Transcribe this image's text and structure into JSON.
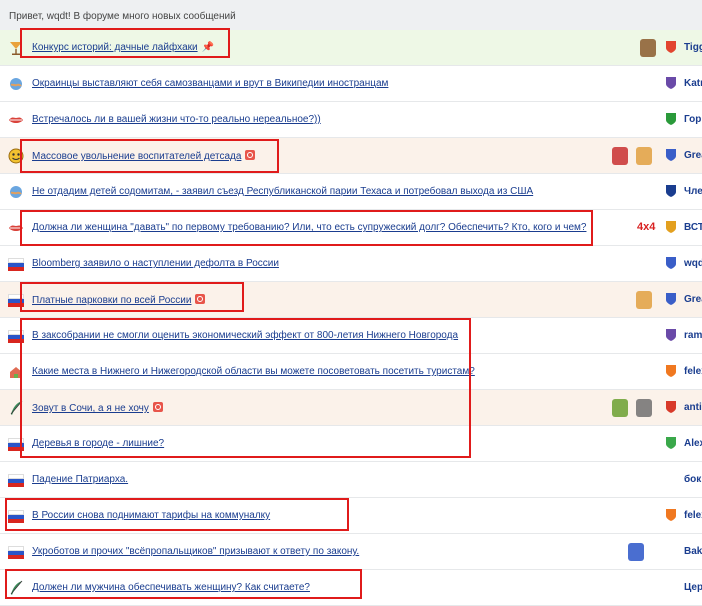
{
  "header": {
    "greeting": "Привет, wqdt! В форуме много новых сообщений"
  },
  "rows": [
    {
      "title": "Конкурс историй: дачные лайфхаки",
      "user": "Tigg",
      "icon": "cocktail-icon",
      "style": "green",
      "extra": "pin"
    },
    {
      "title": "Окраинцы выставляют себя самозванцами и врут в Википедии иностранцам",
      "user": "Katr",
      "icon": "globe-icon"
    },
    {
      "title": "Встречалось ли в вашей жизни что-то реально нереальное?))",
      "user": "Гори",
      "icon": "lips-icon"
    },
    {
      "title": "Массовое увольнение воспитателей детсада",
      "user": "Grea",
      "icon": "smiley-icon",
      "style": "peach",
      "extra": "badge"
    },
    {
      "title": "Не отдадим детей содомитам, - заявил съезд Республиканской парии Техаса и потребовал выхода из США",
      "user": "Чле",
      "icon": "globe-icon"
    },
    {
      "title": "Должна ли женщина \"давать\" по первому требованию? Или, что есть супружеский долг? Обеспечить? Кто, кого и чем?",
      "user": "ВСТ",
      "icon": "lips-icon",
      "tag": "4x4"
    },
    {
      "title": "Bloomberg заявило о наступлении дефолта в России",
      "user": "wqd",
      "icon": "flag-icon"
    },
    {
      "title": "Платные парковки по всей России",
      "user": "Grea",
      "icon": "flag-icon",
      "style": "peach",
      "extra": "badge"
    },
    {
      "title": "В заксобрании не смогли оценить экономический эффект от 800-летия Нижнего Новгорода",
      "user": "rama",
      "icon": "flag-icon"
    },
    {
      "title": "Какие места в Нижнего и Нижегородской области вы можете посоветовать посетить туристам?",
      "user": "felex",
      "icon": "house-icon"
    },
    {
      "title": "Зовут в Сочи, а я не хочу",
      "user": "antic",
      "icon": "feather-icon",
      "style": "peach",
      "extra": "badge"
    },
    {
      "title": "Деревья в городе - лишние?",
      "user": "Alex",
      "icon": "flag-icon"
    },
    {
      "title": "Падение Патриарха.",
      "user": "бок",
      "icon": "flag-icon"
    },
    {
      "title": "В России снова поднимают тарифы на коммуналку",
      "user": "felex",
      "icon": "flag-icon"
    },
    {
      "title": "Укроботов и прочих \"всёпропальщиков\" призывают к ответу по закону.",
      "user": "Bakt",
      "icon": "flag-icon"
    },
    {
      "title": "Должен ли мужчина обеспечивать женщину? Как считаете?",
      "user": "Цер",
      "icon": "feather-icon"
    }
  ],
  "colors": {
    "link": "#1a3d8f",
    "highlight": "#e01b1b",
    "green_row": "#eef8e6",
    "peach_row": "#fbf2ea"
  }
}
